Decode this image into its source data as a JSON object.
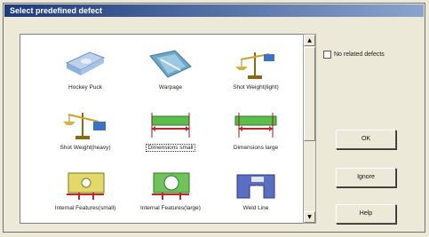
{
  "window": {
    "title": "Select predefined defect"
  },
  "defects": [
    {
      "label": "Hockey Puck",
      "icon": "hockey-puck-icon"
    },
    {
      "label": "Warpage",
      "icon": "warpage-icon"
    },
    {
      "label": "Shot Weight(light)",
      "icon": "scale-light-icon"
    },
    {
      "label": "Shot Weight(heavy)",
      "icon": "scale-heavy-icon"
    },
    {
      "label": "Dimensions small",
      "icon": "dimension-small-icon"
    },
    {
      "label": "Dimensions large",
      "icon": "dimension-large-icon"
    },
    {
      "label": "Internal Features(small)",
      "icon": "internal-small-icon"
    },
    {
      "label": "Internal Features(large)",
      "icon": "internal-large-icon"
    },
    {
      "label": "Weld Line",
      "icon": "weld-line-icon"
    }
  ],
  "selected_index": 4,
  "options": {
    "no_defect_label": "No related defects",
    "no_defect_checked": false
  },
  "buttons": {
    "ok": "OK",
    "ignore": "Ignore",
    "help": "Help"
  },
  "colors": {
    "title_bar_start": "#1d3a7a",
    "title_bar_end": "#8aa4ce",
    "dialog_bg": "#ece9d8"
  }
}
